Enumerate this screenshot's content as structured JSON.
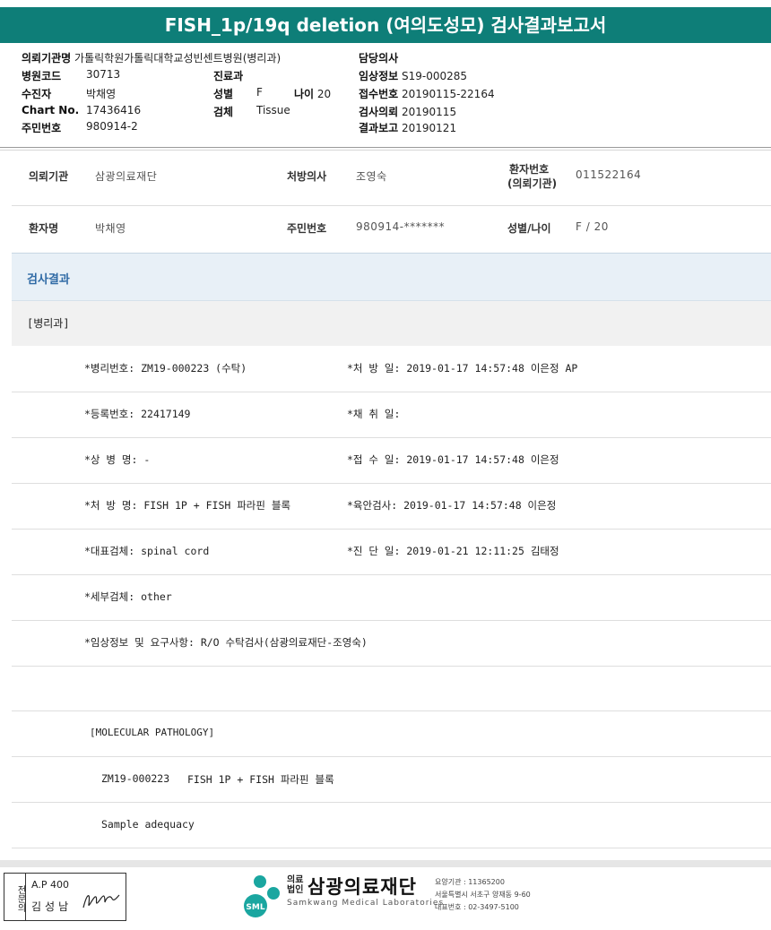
{
  "title": "FISH_1p/19q deletion (여의도성모) 검사결과보고서",
  "header": {
    "institution": {
      "label": "의뢰기관명",
      "value": "가톨릭학원가톨릭대학교성빈센트병원(병리과)"
    },
    "attending_doctor": {
      "label": "담당의사",
      "value": ""
    },
    "hospital_code": {
      "label": "병원코드",
      "value": "30713"
    },
    "department": {
      "label": "진료과",
      "value": ""
    },
    "clinical_info": {
      "label": "임상정보",
      "value": "S19-000285"
    },
    "patient": {
      "label": "수진자",
      "value": "박채영"
    },
    "sex": {
      "label": "성별",
      "value": "F"
    },
    "age": {
      "label": "나이",
      "value": "20"
    },
    "receipt_no": {
      "label": "접수번호",
      "value": "20190115-22164"
    },
    "chart_no": {
      "label": "Chart No.",
      "value": "17436416"
    },
    "specimen": {
      "label": "검체",
      "value": "Tissue"
    },
    "request_date": {
      "label": "검사의뢰",
      "value": "20190115"
    },
    "resident_no": {
      "label": "주민번호",
      "value": "980914-2"
    },
    "report_date": {
      "label": "결과보고",
      "value": "20190121"
    }
  },
  "patient_info": {
    "requesting_org": {
      "label": "의뢰기관",
      "value": "삼광의료재단"
    },
    "prescriber": {
      "label": "처방의사",
      "value": "조영숙"
    },
    "patient_no_label_1": "환자번호",
    "patient_no_label_2": "(의뢰기관)",
    "patient_no_value": "011522164",
    "patient_name": {
      "label": "환자명",
      "value": "박채영"
    },
    "resident_no": {
      "label": "주민번호",
      "value": "980914-*******"
    },
    "sex_age": {
      "label": "성별/나이",
      "value": "F / 20"
    }
  },
  "results": {
    "section_title": "검사결과",
    "department": "[병리과]",
    "rows": [
      {
        "left": "*병리번호: ZM19-000223 (수탁)",
        "right": "*처 방 일: 2019-01-17 14:57:48  이은정 AP"
      },
      {
        "left": "*등록번호: 22417149",
        "right": "*채 취 일:"
      },
      {
        "left": "*상 병 명: -",
        "right": "*접 수 일: 2019-01-17 14:57:48  이은정"
      },
      {
        "left": "*처 방 명: FISH 1P + FISH 파라핀 블록",
        "right": "*육안검사: 2019-01-17 14:57:48  이은정"
      },
      {
        "left": "*대표검체: spinal cord",
        "right": "*진 단 일: 2019-01-21 12:11:25  김태정"
      },
      {
        "left": "*세부검체: other",
        "right": ""
      },
      {
        "left": "*임상정보 및 요구사항: R/O 수탁검사(삼광의료재단-조영숙)",
        "right": ""
      }
    ],
    "molecular_heading": "[MOLECULAR PATHOLOGY]",
    "test_code": "ZM19-000223",
    "test_name": "FISH 1P + FISH 파라핀 블록",
    "sample_line": "Sample adequacy"
  },
  "footer": {
    "specialist_label": "전문의",
    "license": "A.P 400",
    "specialist_name": "김성남",
    "logo_badge": "SML",
    "org_type": "의료법인",
    "org_name": "삼광의료재단",
    "org_name_en": "Samkwang Medical Laboratories",
    "org_code": "요양기관 : 11365200",
    "address": "서울특별시 서초구 양재동 9-60",
    "phone": "대표번호 : 02-3497-5100"
  }
}
